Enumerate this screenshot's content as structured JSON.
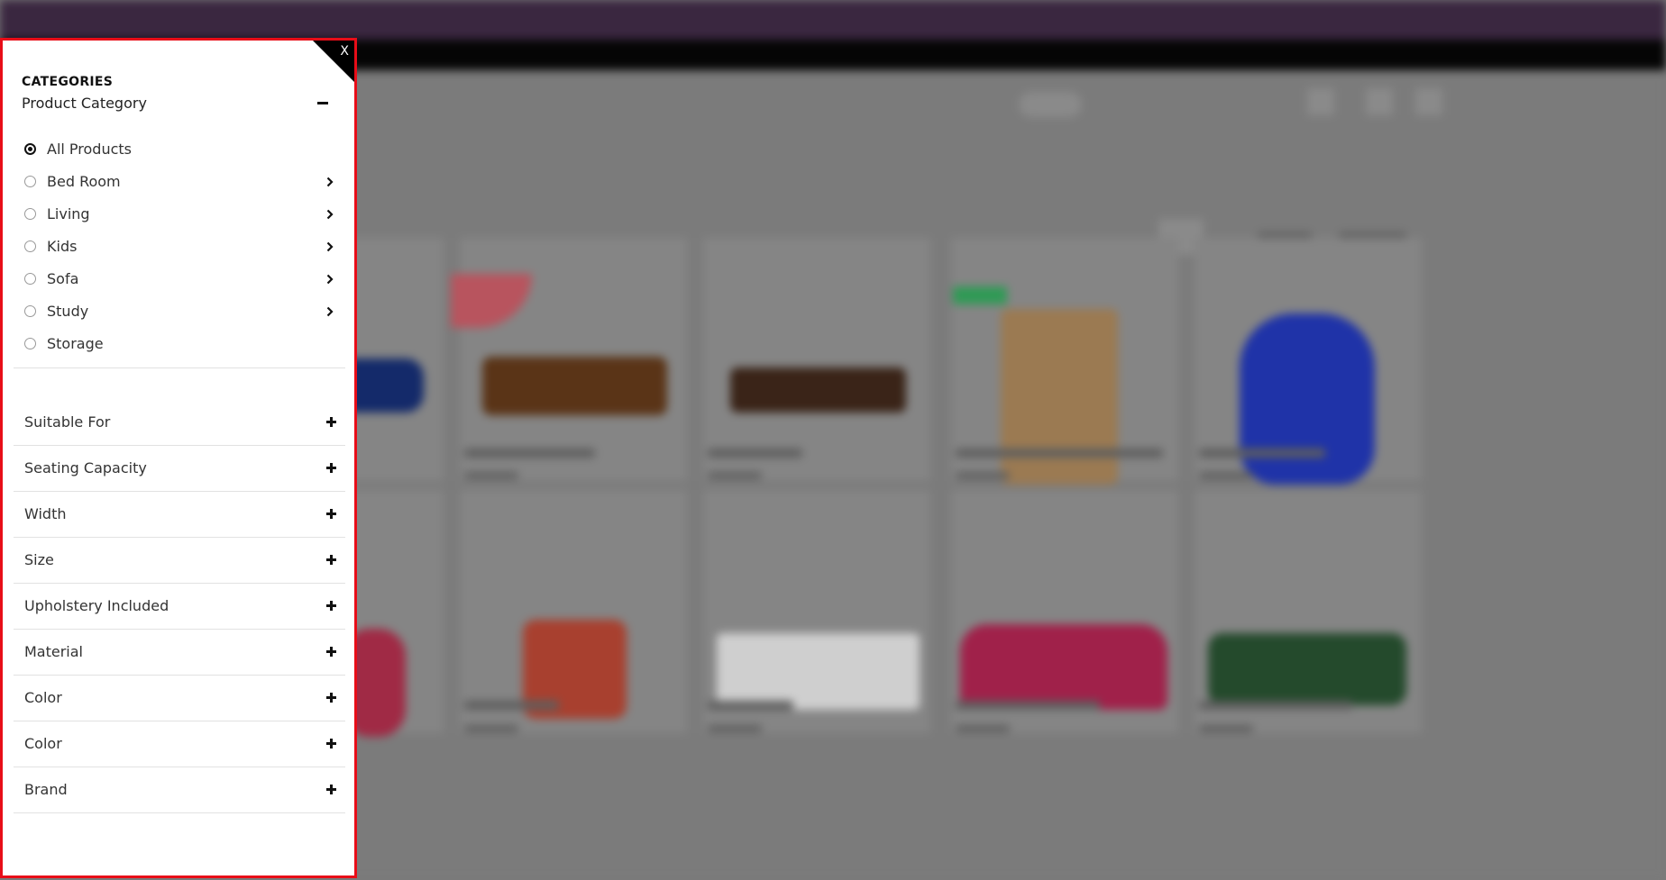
{
  "sidebar": {
    "close_label": "X",
    "heading": "CATEGORIES",
    "category_title": "Product Category",
    "options": [
      {
        "label": "All Products",
        "checked": true,
        "has_children": false
      },
      {
        "label": "Bed Room",
        "checked": false,
        "has_children": true
      },
      {
        "label": "Living",
        "checked": false,
        "has_children": true
      },
      {
        "label": "Kids",
        "checked": false,
        "has_children": true
      },
      {
        "label": "Sofa",
        "checked": false,
        "has_children": true
      },
      {
        "label": "Study",
        "checked": false,
        "has_children": true
      },
      {
        "label": "Storage",
        "checked": false,
        "has_children": false
      }
    ],
    "filters": [
      {
        "label": "Suitable For"
      },
      {
        "label": "Seating Capacity"
      },
      {
        "label": "Width"
      },
      {
        "label": "Size"
      },
      {
        "label": "Upholstery Included"
      },
      {
        "label": "Material"
      },
      {
        "label": "Color"
      },
      {
        "label": "Color"
      },
      {
        "label": "Brand"
      }
    ]
  },
  "colors": {
    "sidebar_border": "#e80d18",
    "topbar": "#3a2740"
  }
}
